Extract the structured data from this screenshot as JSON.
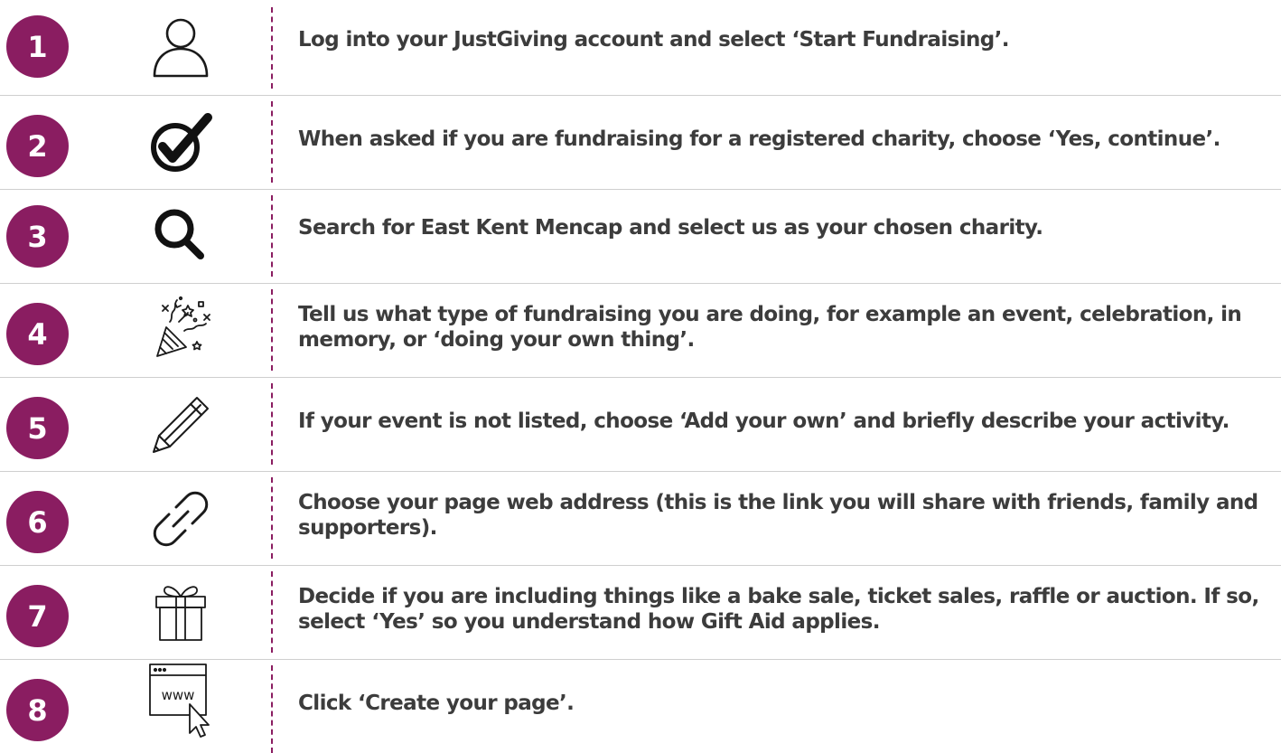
{
  "brand_color": "#8a1d61",
  "text_color": "#3c3c3c",
  "steps": [
    {
      "number": "1",
      "icon": "user-icon",
      "text": "Log into your JustGiving account and select ‘Start Fundraising’."
    },
    {
      "number": "2",
      "icon": "check-circle-icon",
      "text": "When asked if you are fundraising for a registered charity, choose ‘Yes, continue’."
    },
    {
      "number": "3",
      "icon": "search-icon",
      "text": "Search for East Kent Mencap and select us as your chosen charity."
    },
    {
      "number": "4",
      "icon": "party-popper-icon",
      "text": "Tell us what type of fundraising you are doing, for example an event, celebration, in memory, or ‘doing your own thing’."
    },
    {
      "number": "5",
      "icon": "pencil-icon",
      "text": "If your event is not listed, choose ‘Add your own’ and briefly describe your activity."
    },
    {
      "number": "6",
      "icon": "link-icon",
      "text": "Choose your page web address (this is the link you will share with friends, family and supporters)."
    },
    {
      "number": "7",
      "icon": "gift-icon",
      "text": "Decide if you are including things like a bake sale, ticket sales, raffle or auction. If so, select ‘Yes’ so you understand how Gift Aid applies."
    },
    {
      "number": "8",
      "icon": "browser-www-icon",
      "icon_label": "www",
      "text": "Click ‘Create your page’."
    }
  ]
}
